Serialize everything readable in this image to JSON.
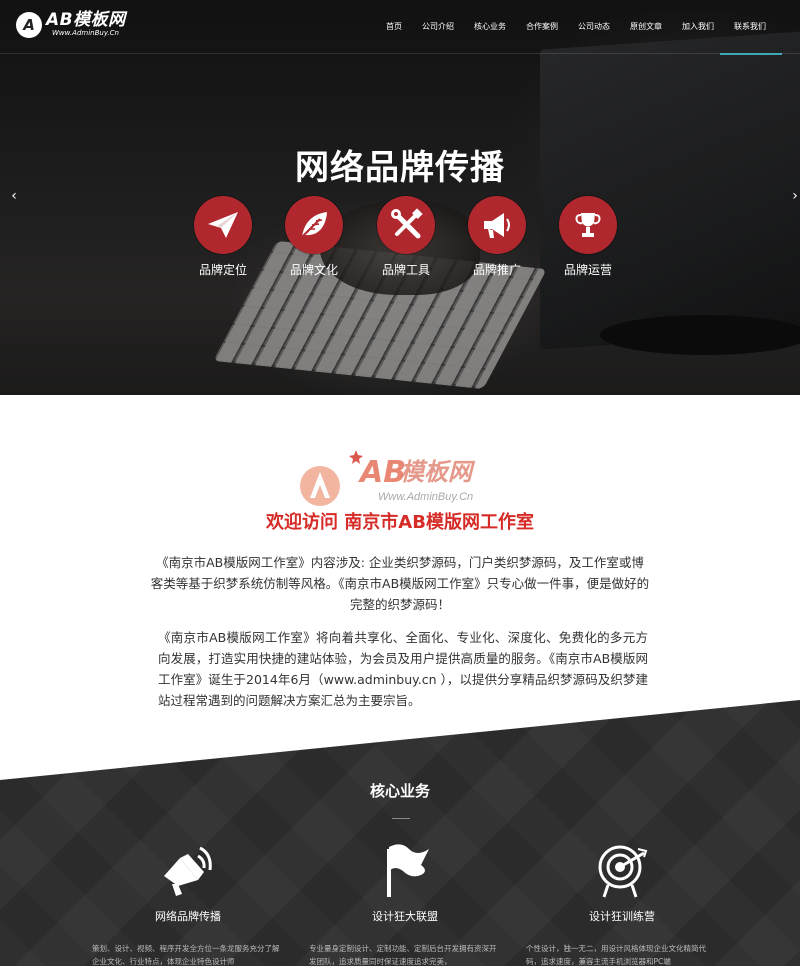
{
  "header": {
    "logo_mark": "A",
    "logo_title": "AB模板网",
    "logo_subtitle": "Www.AdminBuy.Cn",
    "nav": [
      {
        "label": "首页"
      },
      {
        "label": "公司介绍"
      },
      {
        "label": "核心业务"
      },
      {
        "label": "合作案例"
      },
      {
        "label": "公司动态"
      },
      {
        "label": "原创文章"
      },
      {
        "label": "加入我们"
      },
      {
        "label": "联系我们",
        "active": true
      }
    ]
  },
  "hero": {
    "title": "网络品牌传播",
    "prev_arrow": "‹",
    "next_arrow": "›",
    "items": [
      {
        "label": "品牌定位",
        "icon": "paper-plane-icon"
      },
      {
        "label": "品牌文化",
        "icon": "leaf-icon"
      },
      {
        "label": "品牌工具",
        "icon": "tools-icon"
      },
      {
        "label": "品牌推广",
        "icon": "megaphone-icon"
      },
      {
        "label": "品牌运营",
        "icon": "trophy-icon"
      }
    ]
  },
  "about": {
    "logo_watermark_text": "AB模板网",
    "logo_watermark_url": "Www.AdminBuy.Cn",
    "heading": "欢迎访问 南京市AB模版网工作室",
    "paragraph1": "《南京市AB模版网工作室》内容涉及: 企业类织梦源码，门户类织梦源码，及工作室或博客类等基于织梦系统仿制等风格。《南京市AB模版网工作室》只专心做一件事，便是做好的完整的织梦源码！",
    "paragraph2": "《南京市AB模版网工作室》将向着共享化、全面化、专业化、深度化、免费化的多元方向发展，打造实用快捷的建站体验，为会员及用户提供高质量的服务。《南京市AB模版网工作室》诞生于2014年6月（www.adminbuy.cn ），以提供分享精品织梦源码及织梦建站过程常遇到的问题解决方案汇总为主要宗旨。"
  },
  "services": {
    "title": "核心业务",
    "items": [
      {
        "title": "网络品牌传播",
        "icon": "megaphone-icon",
        "desc": "策划、设计、视频、程序开发全方位一条龙服务充分了解企业文化、行业特点，体现企业特色设计师"
      },
      {
        "title": "设计狂大联盟",
        "icon": "flag-icon",
        "desc": "专业量身定制设计、定制功能、定制后台开发拥有资深开发团队，追求质量同时保证速度追求完美，"
      },
      {
        "title": "设计狂训练营",
        "icon": "target-icon",
        "desc": "个性设计，独一无二，用设计风格体现企业文化精简代码，追求速度，兼容主流手机浏览器和PC端"
      }
    ]
  }
}
